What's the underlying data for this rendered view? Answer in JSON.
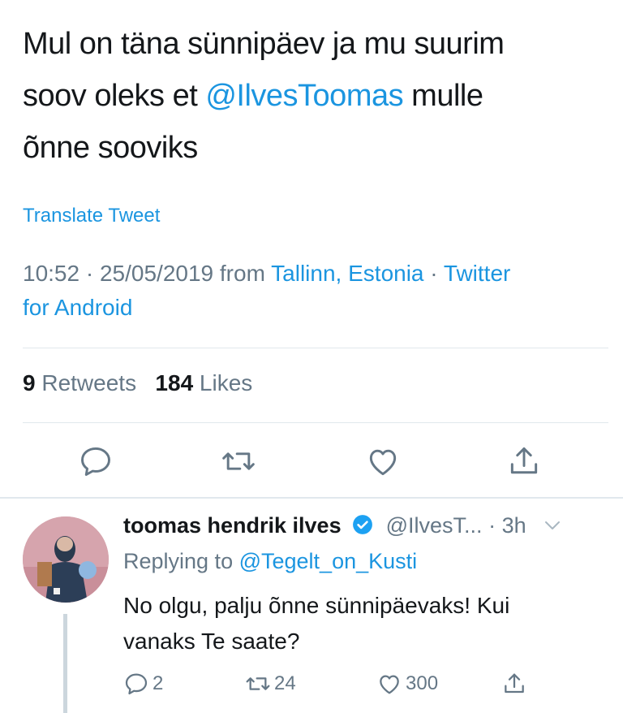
{
  "tweet": {
    "line1": "Mul on täna sünnipäev ja mu suurim",
    "line2_pre": "soov oleks et ",
    "line2_mention": "@IlvesToomas",
    "line2_post": " mulle",
    "line3": "õnne sooviks",
    "translate_label": "Translate Tweet",
    "time": "10:52",
    "separator": " · ",
    "date": "25/05/2019",
    "from_label": " from ",
    "location": "Tallinn, Estonia",
    "source_part1": "Twitter",
    "source_part2": "for Android",
    "retweets_count": "9",
    "retweets_label": " Retweets",
    "likes_count": "184",
    "likes_label": " Likes"
  },
  "reply": {
    "name": "toomas hendrik ilves",
    "handle": "@IlvesT...",
    "time": " · 3h",
    "replying_label": "Replying to ",
    "replying_handle": "@Tegelt_on_Kusti",
    "body_line1": "No olgu, palju õnne sünnipäevaks! Kui",
    "body_line2": "vanaks Te saate?",
    "reply_count": "2",
    "retweet_count": "24",
    "like_count": "300"
  },
  "icons": {
    "reply": "reply-icon",
    "retweet": "retweet-icon",
    "like": "heart-icon",
    "share": "share-icon",
    "verified": "verified-badge-icon",
    "chevron": "chevron-down-icon"
  },
  "colors": {
    "link": "#1b95e0",
    "muted": "#657786",
    "text": "#14171a",
    "divider": "#e1e8ed"
  }
}
